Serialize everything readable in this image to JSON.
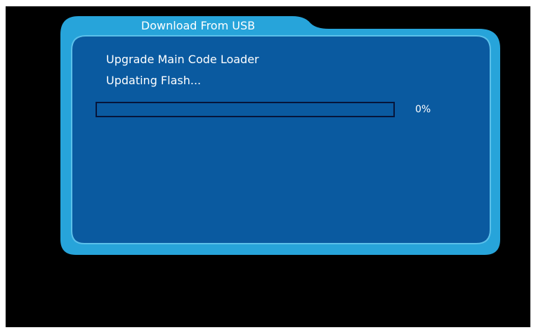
{
  "dialog": {
    "title": "Download From USB",
    "message_line1": "Upgrade Main Code Loader",
    "message_line2": "Updating Flash...",
    "progress": {
      "percent_label": "0%",
      "value": 0
    }
  },
  "colors": {
    "background": "#000000",
    "frame": "#27a4da",
    "panel": "#0a5aa0",
    "panel_outline": "#5bc0ea",
    "text": "#ffffff",
    "progress_border": "#06153a"
  }
}
